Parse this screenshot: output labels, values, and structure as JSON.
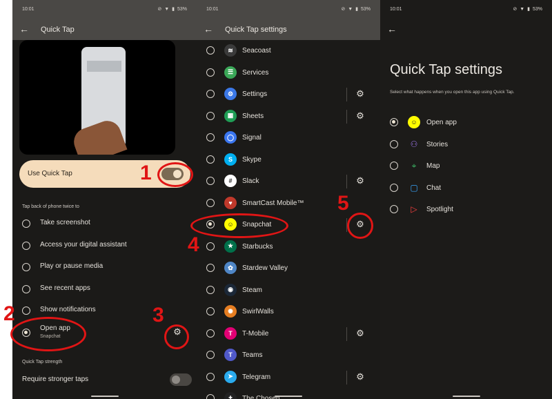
{
  "colors": {
    "accent_red": "#e01515",
    "panel_bg": "#1b1a18",
    "toggle_card": "#f5dcbb"
  },
  "status": {
    "time": "10:01",
    "battery": "53%"
  },
  "panel1": {
    "title": "Quick Tap",
    "use_quick_tap_label": "Use Quick Tap",
    "use_quick_tap_on": true,
    "section_header": "Tap back of phone twice to",
    "options": [
      {
        "label": "Take screenshot",
        "selected": false
      },
      {
        "label": "Access your digital assistant",
        "selected": false
      },
      {
        "label": "Play or pause media",
        "selected": false
      },
      {
        "label": "See recent apps",
        "selected": false
      },
      {
        "label": "Show notifications",
        "selected": false
      },
      {
        "label": "Open app",
        "sub": "Snapchat",
        "selected": true
      }
    ],
    "strength_header": "Quick Tap strength",
    "stronger_label": "Require stronger taps",
    "stronger_on": false
  },
  "panel2": {
    "title": "Quick Tap settings",
    "apps": [
      {
        "label": "Seacoast",
        "icon": "seacoast-icon",
        "gear": false,
        "selected": false,
        "color": "#3a3a3a",
        "glyph": "≋"
      },
      {
        "label": "Services",
        "icon": "services-icon",
        "gear": false,
        "selected": false,
        "color": "#3aa757",
        "glyph": "☰"
      },
      {
        "label": "Settings",
        "icon": "settings-app-icon",
        "gear": true,
        "selected": false,
        "color": "#3b78e7",
        "glyph": "⚙"
      },
      {
        "label": "Sheets",
        "icon": "sheets-icon",
        "gear": true,
        "selected": false,
        "color": "#1f9d55",
        "glyph": "▦"
      },
      {
        "label": "Signal",
        "icon": "signal-icon",
        "gear": false,
        "selected": false,
        "color": "#3a76f0",
        "glyph": "◯"
      },
      {
        "label": "Skype",
        "icon": "skype-icon",
        "gear": false,
        "selected": false,
        "color": "#00aff0",
        "glyph": "S"
      },
      {
        "label": "Slack",
        "icon": "slack-icon",
        "gear": true,
        "selected": false,
        "color": "#ffffff",
        "glyph": "#"
      },
      {
        "label": "SmartCast Mobile™",
        "icon": "smartcast-icon",
        "gear": false,
        "selected": false,
        "color": "#c0392b",
        "glyph": "♥"
      },
      {
        "label": "Snapchat",
        "icon": "snapchat-icon",
        "gear": true,
        "selected": true,
        "color": "#fffc00",
        "glyph": "☺"
      },
      {
        "label": "Starbucks",
        "icon": "starbucks-icon",
        "gear": false,
        "selected": false,
        "color": "#00704a",
        "glyph": "★"
      },
      {
        "label": "Stardew Valley",
        "icon": "stardew-icon",
        "gear": false,
        "selected": false,
        "color": "#4f86c6",
        "glyph": "✿"
      },
      {
        "label": "Steam",
        "icon": "steam-icon",
        "gear": false,
        "selected": false,
        "color": "#1b2838",
        "glyph": "◉"
      },
      {
        "label": "SwirlWalls",
        "icon": "swirlwalls-icon",
        "gear": false,
        "selected": false,
        "color": "#e67e22",
        "glyph": "✺"
      },
      {
        "label": "T-Mobile",
        "icon": "tmobile-icon",
        "gear": true,
        "selected": false,
        "color": "#e20074",
        "glyph": "T"
      },
      {
        "label": "Teams",
        "icon": "teams-icon",
        "gear": false,
        "selected": false,
        "color": "#5059c9",
        "glyph": "T"
      },
      {
        "label": "Telegram",
        "icon": "telegram-icon",
        "gear": true,
        "selected": false,
        "color": "#2aabee",
        "glyph": "➤"
      },
      {
        "label": "The Chosen",
        "icon": "thechosen-icon",
        "gear": false,
        "selected": false,
        "color": "#222222",
        "glyph": "✝"
      }
    ]
  },
  "panel3": {
    "title": "Quick Tap settings",
    "description": "Select what happens when you open this app using Quick Tap.",
    "options": [
      {
        "label": "Open app",
        "icon": "snapchat-icon",
        "selected": true,
        "color": "#fffc00",
        "glyph": "☺"
      },
      {
        "label": "Stories",
        "icon": "stories-icon",
        "selected": false,
        "color": "#a178f0",
        "glyph": "⚇"
      },
      {
        "label": "Map",
        "icon": "map-pin-icon",
        "selected": false,
        "color": "#3fbf6a",
        "glyph": "⌖"
      },
      {
        "label": "Chat",
        "icon": "chat-icon",
        "selected": false,
        "color": "#3aa7ff",
        "glyph": "▢"
      },
      {
        "label": "Spotlight",
        "icon": "spotlight-icon",
        "selected": false,
        "color": "#ff4040",
        "glyph": "▷"
      }
    ]
  },
  "annotations": [
    "1",
    "2",
    "3",
    "4",
    "5"
  ]
}
